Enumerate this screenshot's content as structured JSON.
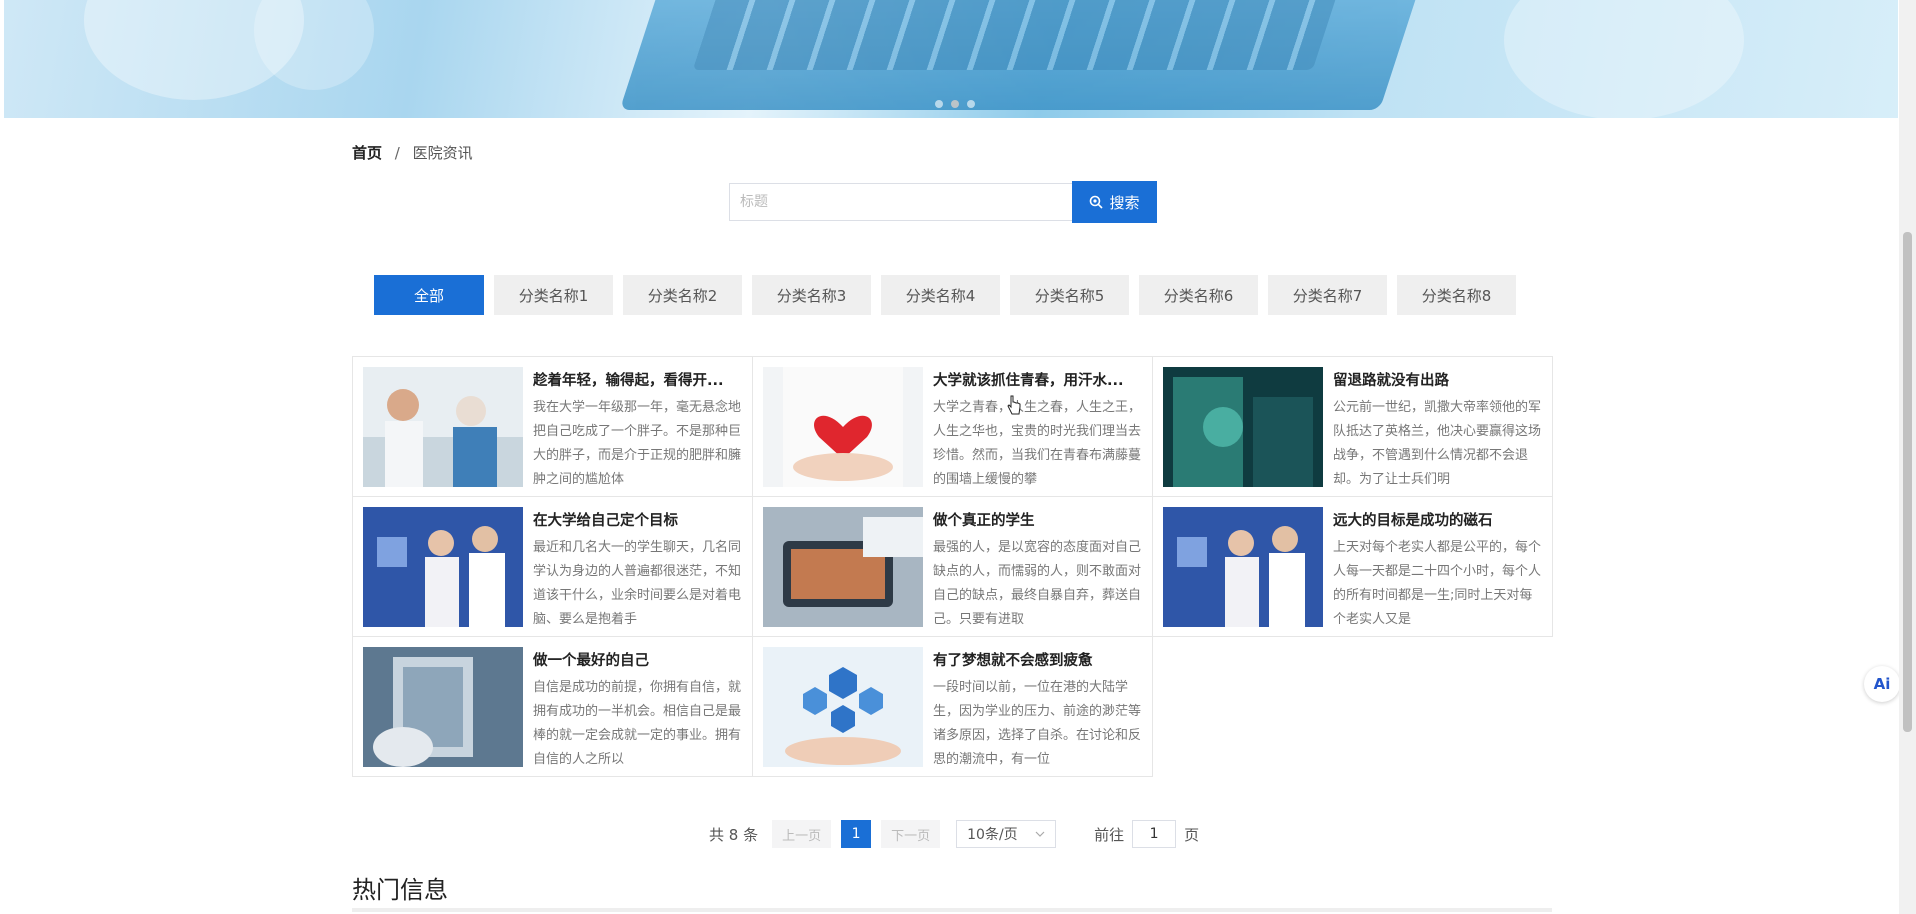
{
  "banner": {
    "slide_count": 3,
    "active_slide": 2
  },
  "breadcrumb": {
    "home": "首页",
    "separator": "/",
    "current": "医院资讯"
  },
  "search": {
    "placeholder": "标题",
    "value": "",
    "button_label": "搜索"
  },
  "tabs": [
    "全部",
    "分类名称1",
    "分类名称2",
    "分类名称3",
    "分类名称4",
    "分类名称5",
    "分类名称6",
    "分类名称7",
    "分类名称8"
  ],
  "active_tab": "全部",
  "articles": [
    {
      "title": "趁着年轻，输得起，看得开...",
      "desc": "我在大学一年级那一年，毫无悬念地把自己吃成了一个胖子。不是那种巨大的胖子，而是介于正规的肥胖和臃肿之间的尴尬体",
      "image": "nurse-elder-photo"
    },
    {
      "title": "大学就该抓住青春，用汗水...",
      "desc": "大学之青春，人生之春，人生之王，人生之华也，宝贵的时光我们理当去珍惜。然而，当我们在青春布满藤蔓的围墙上缓慢的攀",
      "image": "heart-hands-photo"
    },
    {
      "title": "留退路就没有出路",
      "desc": "公元前一世纪，凯撒大帝率领他的军队抵达了英格兰，他决心要赢得这场战争，不管遇到什么情况都不会退却。为了让士兵们明",
      "image": "surgery-photo"
    },
    {
      "title": "在大学给自己定个目标",
      "desc": "最近和几名大一的学生聊天，几名同学认为身边的人普遍都很迷茫，不知道该干什么，业余时间要么是对着电脑、要么是抱着手",
      "image": "doctors-photo"
    },
    {
      "title": "做个真正的学生",
      "desc": "最强的人，是以宽容的态度面对自己缺点的人，而懦弱的人，则不敢面对自己的缺点，最终自暴自弃，葬送自己。只要有进取",
      "image": "tablet-scan-photo"
    },
    {
      "title": "远大的目标是成功的磁石",
      "desc": "上天对每个老实人都是公平的，每个人每一天都是二十四个小时，每个人的所有时间都是一生;同时上天对每个老实人又是",
      "image": "doctors-photo"
    },
    {
      "title": "做一个最好的自己",
      "desc": "自信是成功的前提，你拥有自信，就拥有成功的一半机会。相信自己是最棒的就一定会成就一定的事业。拥有自信的人之所以",
      "image": "xray-photo"
    },
    {
      "title": "有了梦想就不会感到疲惫",
      "desc": "一段时间以前，一位在港的大陆学生，因为学业的压力、前途的渺茫等诸多原因，选择了自杀。在讨论和反思的潮流中，有一位",
      "image": "medical-icons-hands-photo"
    }
  ],
  "pagination": {
    "total_label": "共 8 条",
    "prev": "上一页",
    "current_page": "1",
    "next": "下一页",
    "page_size": "10条/页",
    "goto_label": "前往",
    "goto_value": "1",
    "page_suffix": "页"
  },
  "hot_section": {
    "title": "热门信息"
  },
  "floating": {
    "ai_label": "Ai"
  },
  "colors": {
    "primary": "#1a6fd6",
    "tab_bg": "#efefef",
    "border": "#e6e6e6"
  }
}
